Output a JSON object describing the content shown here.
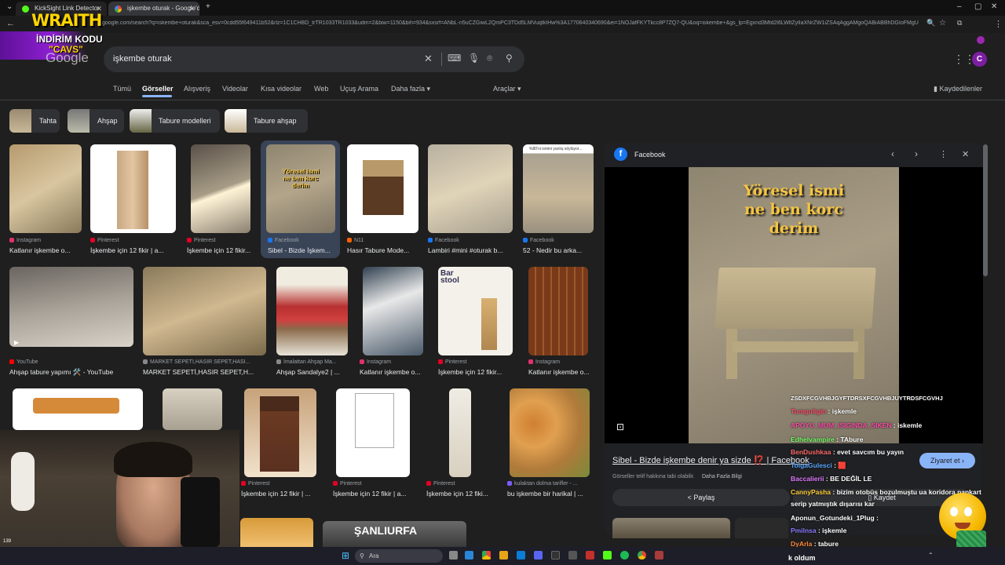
{
  "browser": {
    "tabs": [
      {
        "label": "KickSight Link Detector",
        "active": false
      },
      {
        "label": "işkembe oturak - Google'da Ar",
        "active": true
      }
    ],
    "url": "google.com/search?q=iskembe+oturak&sca_esv=0cdd55f649411b52&rlz=1C1CHBD_trTR1033TR1033&udm=2&biw=1150&bih=934&sxsrf=ANbL-n5uCZGiwL2QmPC3TDd5LMVuqtkIHw%3A1770640340690&ei=1NOJafFKYTkcc8P7ZQ7-QU&oq=iskembe+&gs_lp=Egxnd3Mtd2l6LWltZylIaXNrZW1iZSAqAggAMgoQABiABBhDGIoFMgUQABiABDIKEAAYgA..."
  },
  "overlay": {
    "brand": "WRAITH",
    "promo_line1": "İNDİRİM KODU",
    "promo_line2": "\"CAVS\"",
    "stream_title": "k oldum"
  },
  "google": {
    "logo": "Google",
    "query": "işkembe oturak",
    "account_initial": "C",
    "tabs": [
      "Tümü",
      "Görseller",
      "Alışveriş",
      "Videolar",
      "Kısa videolar",
      "Web",
      "Uçuş Arama",
      "Daha fazla"
    ],
    "active_tab": "Görseller",
    "tools": "Araçlar",
    "saved": "Kaydedilenler",
    "chips": [
      "Tahta",
      "Ahşap",
      "Tabure modelleri",
      "Tabure ahşap"
    ]
  },
  "results": {
    "row1": [
      {
        "source": "Instagram",
        "title": "Katlanır işkembe o..."
      },
      {
        "source": "Pinterest",
        "title": "İşkembe için 12 fikir | a..."
      },
      {
        "source": "Pinterest",
        "title": "İşkembe için 12 fikir..."
      },
      {
        "source": "Facebook",
        "title": "Sibel - Bizde İşkem..."
      },
      {
        "source": "N11",
        "title": "Hasır Tabure Mode..."
      },
      {
        "source": "Facebook",
        "title": "Lambiri #mini #oturak b..."
      },
      {
        "source": "Facebook",
        "title": "52 - Nedir bu arka..."
      }
    ],
    "row1_caption": "%80'ni ismini yanlış söylüyor...",
    "row2": [
      {
        "source": "YouTube",
        "title": "Ahşap tabure yapımı 🛠️ - YouTube"
      },
      {
        "source": "MARKET SEPETİ,HASIR SEPET,HASI...",
        "title": "MARKET SEPETİ,HASIR SEPET,H..."
      },
      {
        "source": "İmalattan Ahşap Ma...",
        "title": "Ahşap Sandalye2 | ..."
      },
      {
        "source": "Instagram",
        "title": "Katlanır işkembe o..."
      },
      {
        "source": "Pinterest",
        "title": "İşkembe için 12 fikir..."
      },
      {
        "source": "Instagram",
        "title": "Katlanır işkembe o..."
      }
    ],
    "row2_bar_stool": "Bar stool",
    "row3": [
      {
        "source": "Pinterest",
        "title": "İşkembe için 12 fikir | ..."
      },
      {
        "source": "Pinterest",
        "title": "İşkembe için 12 fikir | a..."
      },
      {
        "source": "Pinterest",
        "title": "İşkembe için 12 fiki..."
      },
      {
        "source": "kulaktan dolma tarifler - ...",
        "title": "bu işkembe bir harikal | ..."
      }
    ],
    "row4_sign": "ŞANLIURFA"
  },
  "panel": {
    "source": "Facebook",
    "image_text": [
      "Yöresel ismi",
      "ne ben korc",
      "derim"
    ],
    "title": "Sibel - Bizde işkembe denir ya sizde ⁉️ | Facebook",
    "visit": "Ziyaret et",
    "copyright": "Görseller telif hakkına tabi olabilir.",
    "more_info": "Daha Fazla Bilgi",
    "share": "Paylaş",
    "save": "Kaydet"
  },
  "chat": [
    {
      "user": "",
      "msg": "ZSDXFCGVHBJGYFTDRSXFCGVHBJUYTRDSFCGVHJ",
      "color": "#ffffff"
    },
    {
      "user": "Tumguligin",
      "msg": ": işkemle",
      "color": "#ff4f6e"
    },
    {
      "user": "APOYU_MUM_ISIGINDA_SIKEN",
      "msg": ": iskemle",
      "color": "#ff4ba8"
    },
    {
      "user": "Edhelvampire",
      "msg": ": TAbure",
      "color": "#7cff6e"
    },
    {
      "user": "BenDushkaa",
      "msg": ": evet savcım bu yayın",
      "color": "#ff6b6b"
    },
    {
      "user": "TolgaGulesci",
      "msg": ": 🟥",
      "color": "#5aa7ff"
    },
    {
      "user": "Baccalierii",
      "msg": ": BE DEĞİL LE",
      "color": "#e07bff"
    },
    {
      "user": "CannyPasha",
      "msg": ": bizim otobüs bozulmuştu ua koridora pankart",
      "color": "#ffce3a"
    },
    {
      "user": "",
      "msg": "serip yatmıştık dışarısı kar",
      "color": "#ffffff"
    },
    {
      "user": "Aponun_Gotundeki_1Plug",
      "msg": ":",
      "color": "#ffffff"
    },
    {
      "user": "Pmilnsa",
      "msg": ": işkemle",
      "color": "#8a7bff"
    },
    {
      "user": "DyArla",
      "msg": ": tabure",
      "color": "#ff8a3d"
    }
  ],
  "taskbar": {
    "search": "Ara"
  },
  "colors": {
    "accent": "#8ab4f8",
    "bg": "#1f1f1f",
    "wraith": "#ffd400",
    "promo": "#a020f0"
  },
  "webcam_number": "139"
}
